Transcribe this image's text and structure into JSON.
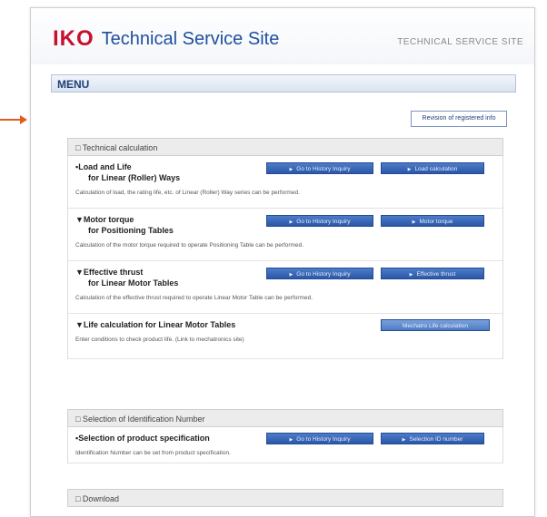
{
  "header": {
    "logo": "IKO",
    "site_title": "Technical Service Site",
    "sub_title": "TECHNICAL SERVICE SITE"
  },
  "menu": {
    "title": "MENU"
  },
  "revision_button": "Revision of registered info",
  "sections": {
    "technical": {
      "title": "□ Technical calculation",
      "items": [
        {
          "title_line1": "▪Load and Life",
          "title_line2": "for Linear (Roller) Ways",
          "desc": "Calculation of load, the rating life, etc. of Linear (Roller) Way series can be performed.",
          "btn1": "Go to History Inquiry",
          "btn2": "Load calculation"
        },
        {
          "title_line1": "▼Motor torque",
          "title_line2": "for Positioning Tables",
          "desc": "Calculation of the motor torque required to operate Positioning Table can be performed.",
          "btn1": "Go to History Inquiry",
          "btn2": "Motor torque"
        },
        {
          "title_line1": "▼Effective thrust",
          "title_line2": "for Linear Motor Tables",
          "desc": "Calculation of the effective thrust required to operate Linear Motor Table can be performed.",
          "btn1": "Go to History Inquiry",
          "btn2": "Effective thrust"
        },
        {
          "title_line1": "▼Life calculation for Linear Motor Tables",
          "title_line2": "",
          "desc": "Enter conditions to check product life.   (Link to mechatronics site)",
          "btn1": "",
          "btn2": "Mechatro Life calculation"
        }
      ]
    },
    "identification": {
      "title": "□ Selection of Identification Number",
      "items": [
        {
          "title_line1": "▪Selection of product specification",
          "desc": "Identification Number can be set from product specification.",
          "btn1": "Go to History Inquiry",
          "btn2": "Selection ID number"
        }
      ]
    },
    "download": {
      "title": "□ Download"
    }
  },
  "colors": {
    "brand_red": "#c8102e",
    "brand_blue": "#1f4fa0",
    "button_blue": "#2a57a8",
    "arrow": "#e55a1f"
  },
  "icons": {
    "arrow": "arrow-right-icon"
  }
}
